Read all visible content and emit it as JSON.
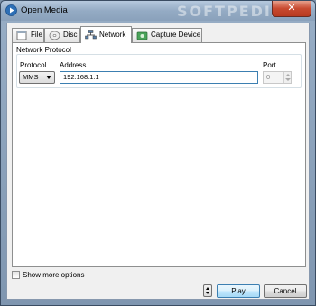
{
  "window": {
    "title": "Open Media",
    "watermark": "SOFTPEDIA",
    "close_glyph": "✕"
  },
  "tabs": [
    {
      "label": "File",
      "icon": "file-icon",
      "active": false
    },
    {
      "label": "Disc",
      "icon": "disc-icon",
      "active": false
    },
    {
      "label": "Network",
      "icon": "network-icon",
      "active": true
    },
    {
      "label": "Capture Device",
      "icon": "capture-device-icon",
      "active": false
    }
  ],
  "network": {
    "group_title": "Network Protocol",
    "protocol_label": "Protocol",
    "protocol_value": "MMS",
    "address_label": "Address",
    "address_value": "192.168.1.1",
    "port_label": "Port",
    "port_value": "0"
  },
  "footer": {
    "show_more_options": "Show more options",
    "play": "Play",
    "cancel": "Cancel"
  },
  "colors": {
    "accent": "#3c7fb1",
    "close_button": "#c84a30"
  }
}
